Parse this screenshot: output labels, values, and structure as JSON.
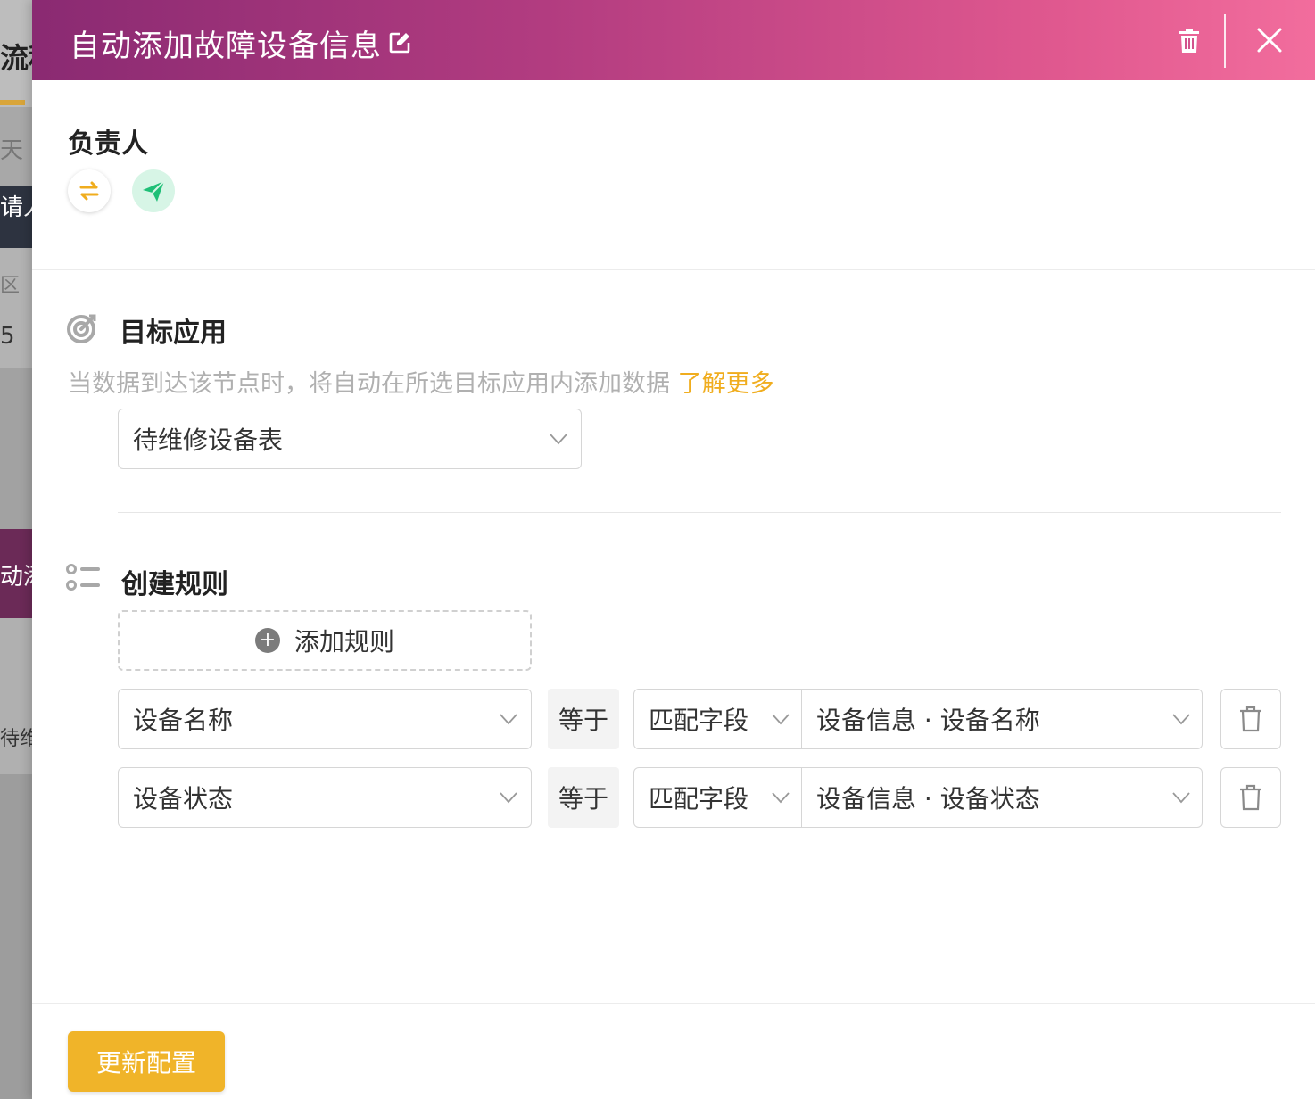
{
  "background": {
    "fragments": [
      "流程",
      "天",
      "请人",
      "区",
      "5",
      "动添",
      "待维"
    ]
  },
  "header": {
    "title": "自动添加故障设备信息",
    "gradient_start": "#8a2a72",
    "gradient_end": "#f26d9d"
  },
  "owner": {
    "label": "负责人"
  },
  "target": {
    "label": "目标应用",
    "description": "当数据到达该节点时，将自动在所选目标应用内添加数据 ",
    "learn_more": "了解更多",
    "selected_app": "待维修设备表"
  },
  "rules": {
    "label": "创建规则",
    "add_label": "添加规则",
    "items": [
      {
        "field": "设备名称",
        "operator": "等于",
        "mode": "匹配字段",
        "source": "设备信息 · 设备名称"
      },
      {
        "field": "设备状态",
        "operator": "等于",
        "mode": "匹配字段",
        "source": "设备信息 · 设备状态"
      }
    ]
  },
  "footer": {
    "update_label": "更新配置",
    "accent": "#f0b429"
  }
}
